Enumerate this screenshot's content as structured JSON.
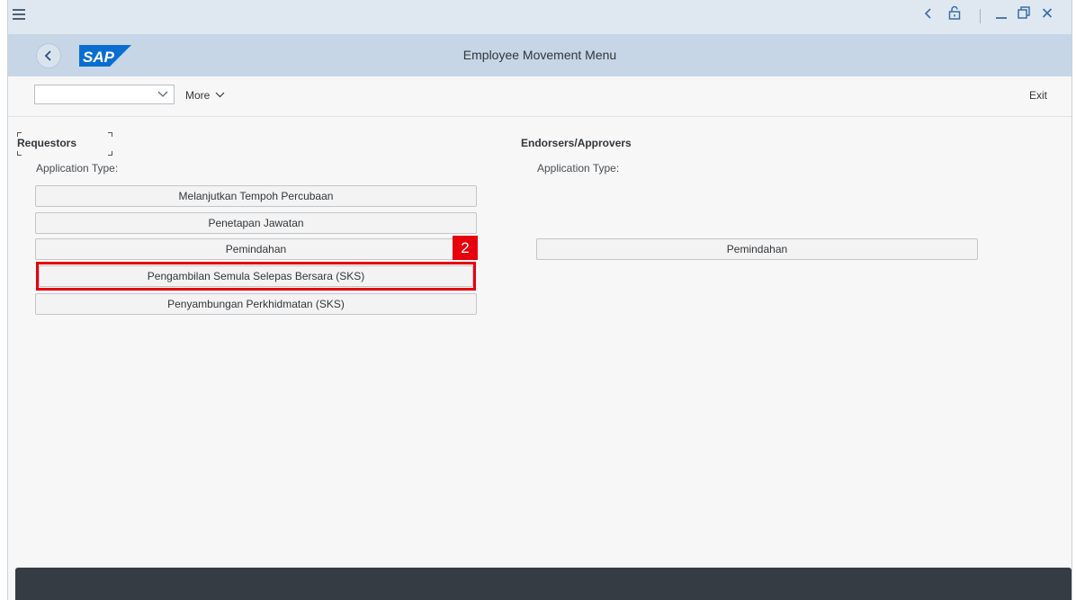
{
  "window": {
    "title": "Employee Movement Menu",
    "brand": "SAP"
  },
  "toolbar": {
    "dropdown_value": "",
    "more_label": "More",
    "exit_label": "Exit"
  },
  "requestors": {
    "title": "Requestors",
    "subtitle": "Application Type:",
    "buttons": [
      "Melanjutkan Tempoh Percubaan",
      "Penetapan Jawatan",
      "Pemindahan",
      "Pengambilan Semula Selepas Bersara (SKS)",
      "Penyambungan Perkhidmatan (SKS)"
    ]
  },
  "approvers": {
    "title": "Endorsers/Approvers",
    "subtitle": "Application Type:",
    "buttons": [
      "Pemindahan"
    ]
  },
  "annotation": {
    "step_number": "2"
  },
  "icons": {
    "menu": "hamburger-icon",
    "back": "back-arrow-icon",
    "lock": "lock-icon",
    "minimize": "minimize-icon",
    "restore": "restore-icon",
    "close": "close-icon"
  },
  "colors": {
    "header_bg": "#c6d6e6",
    "window_bar_bg": "#dfe8f1",
    "highlight": "#e6000e",
    "sap_blue": "#0a6ed1",
    "footer_bg": "#353c44"
  }
}
